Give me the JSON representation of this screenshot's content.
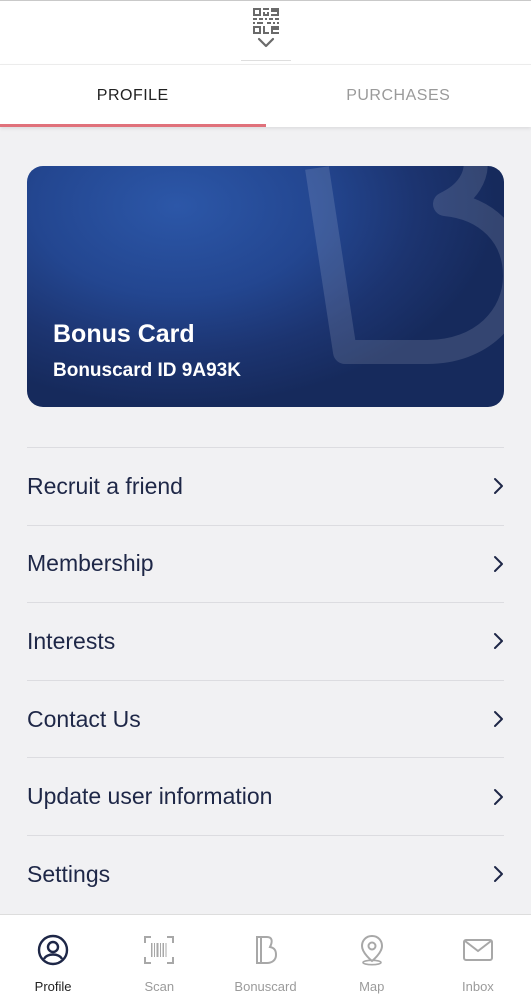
{
  "header": {
    "qr_icon": "qr-code-icon",
    "expand_icon": "chevron-down-icon"
  },
  "tabs": [
    {
      "label": "PROFILE",
      "active": true
    },
    {
      "label": "PURCHASES",
      "active": false
    }
  ],
  "card": {
    "title": "Bonus Card",
    "id_text": "Bonuscard ID 9A93K",
    "colors": {
      "background": "#234690",
      "text": "#ffffff"
    }
  },
  "menu": {
    "items": [
      {
        "label": "Recruit a friend"
      },
      {
        "label": "Membership"
      },
      {
        "label": "Interests"
      },
      {
        "label": "Contact Us"
      },
      {
        "label": "Update user information"
      },
      {
        "label": "Settings"
      }
    ],
    "chevron_icon": "chevron-right-icon"
  },
  "bottom_nav": {
    "items": [
      {
        "label": "Profile",
        "icon": "profile-icon",
        "active": true
      },
      {
        "label": "Scan",
        "icon": "barcode-scan-icon",
        "active": false
      },
      {
        "label": "Bonuscard",
        "icon": "bonuscard-icon",
        "active": false
      },
      {
        "label": "Map",
        "icon": "map-pin-icon",
        "active": false
      },
      {
        "label": "Inbox",
        "icon": "mail-icon",
        "active": false
      }
    ]
  },
  "colors": {
    "accent": "#e0717b",
    "text_dark": "#1e2747",
    "text_muted": "#9b9b9b",
    "background": "#f1f1f3"
  }
}
